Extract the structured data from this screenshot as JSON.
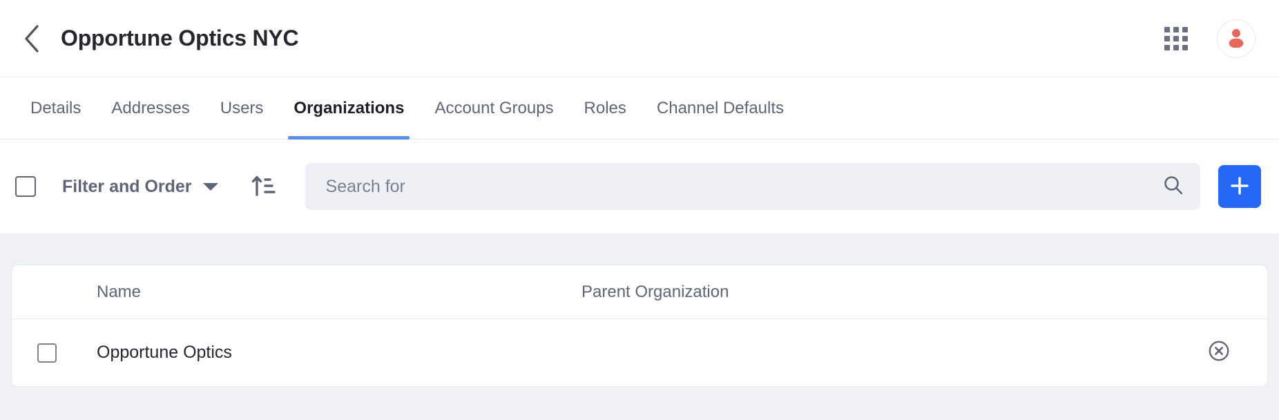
{
  "header": {
    "back_icon": "chevron-left-icon",
    "title": "Opportune Optics NYC",
    "apps_icon": "apps-grid-icon",
    "avatar_icon": "user-avatar-icon",
    "avatar_color": "#e8685c"
  },
  "tabs": {
    "active": "Organizations",
    "active_underline_color": "#5a8ff0",
    "items": [
      {
        "label": "Details"
      },
      {
        "label": "Addresses"
      },
      {
        "label": "Users"
      },
      {
        "label": "Organizations"
      },
      {
        "label": "Account Groups"
      },
      {
        "label": "Roles"
      },
      {
        "label": "Channel Defaults"
      }
    ]
  },
  "toolbar": {
    "select_all_checkbox": "unchecked",
    "filter_label": "Filter and Order",
    "dropdown_icon": "chevron-down-icon",
    "sort_icon": "sort-ascending-icon",
    "search": {
      "value": "",
      "placeholder": "Search for",
      "icon": "search-icon"
    },
    "add_label": "+",
    "add_icon": "plus-icon",
    "add_color": "#2568f5"
  },
  "table": {
    "columns": [
      {
        "key": "name",
        "label": "Name"
      },
      {
        "key": "parent",
        "label": "Parent Organization"
      }
    ],
    "rows": [
      {
        "checkbox": "unchecked",
        "name": "Opportune Optics",
        "parent": "",
        "remove_icon": "circle-close-icon"
      }
    ]
  }
}
